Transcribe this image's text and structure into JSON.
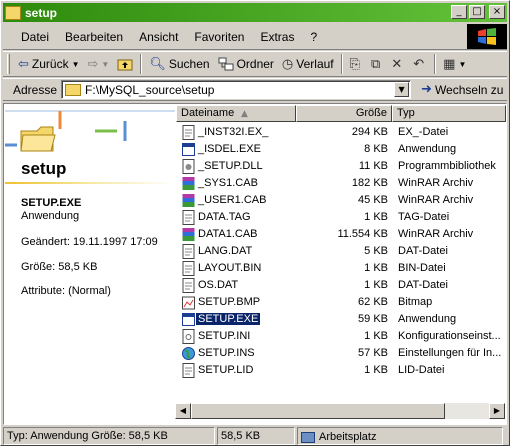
{
  "window": {
    "title": "setup",
    "minimize": "_",
    "maximize": "□",
    "close": "×"
  },
  "menu": [
    "Datei",
    "Bearbeiten",
    "Ansicht",
    "Favoriten",
    "Extras",
    "?"
  ],
  "toolbar": {
    "back": "Zurück",
    "search": "Suchen",
    "folders": "Ordner",
    "history": "Verlauf"
  },
  "address": {
    "label": "Adresse",
    "value": "F:\\MySQL_source\\setup",
    "go": "Wechseln zu"
  },
  "left_pane": {
    "folder_title": "setup",
    "file_name": "SETUP.EXE",
    "file_type": "Anwendung",
    "modified": "Geändert: 19.11.1997 17:09",
    "size": "Größe: 58,5 KB",
    "attributes": "Attribute: (Normal)"
  },
  "columns": {
    "name": "Dateiname",
    "size": "Größe",
    "type": "Typ"
  },
  "files": [
    {
      "name": "_INST32I.EX_",
      "size": "294 KB",
      "type": "EX_-Datei",
      "icon": "doc-icon"
    },
    {
      "name": "_ISDEL.EXE",
      "size": "8 KB",
      "type": "Anwendung",
      "icon": "app-icon"
    },
    {
      "name": "_SETUP.DLL",
      "size": "11 KB",
      "type": "Programmbibliothek",
      "icon": "dll-icon"
    },
    {
      "name": "_SYS1.CAB",
      "size": "182 KB",
      "type": "WinRAR Archiv",
      "icon": "archive-icon"
    },
    {
      "name": "_USER1.CAB",
      "size": "45 KB",
      "type": "WinRAR Archiv",
      "icon": "archive-icon"
    },
    {
      "name": "DATA.TAG",
      "size": "1 KB",
      "type": "TAG-Datei",
      "icon": "doc-icon"
    },
    {
      "name": "DATA1.CAB",
      "size": "11.554 KB",
      "type": "WinRAR Archiv",
      "icon": "archive-icon"
    },
    {
      "name": "LANG.DAT",
      "size": "5 KB",
      "type": "DAT-Datei",
      "icon": "doc-icon"
    },
    {
      "name": "LAYOUT.BIN",
      "size": "1 KB",
      "type": "BIN-Datei",
      "icon": "doc-icon"
    },
    {
      "name": "OS.DAT",
      "size": "1 KB",
      "type": "DAT-Datei",
      "icon": "doc-icon"
    },
    {
      "name": "SETUP.BMP",
      "size": "62 KB",
      "type": "Bitmap",
      "icon": "bitmap-icon"
    },
    {
      "name": "SETUP.EXE",
      "size": "59 KB",
      "type": "Anwendung",
      "icon": "app-icon",
      "selected": true
    },
    {
      "name": "SETUP.INI",
      "size": "1 KB",
      "type": "Konfigurationseinst...",
      "icon": "ini-icon"
    },
    {
      "name": "SETUP.INS",
      "size": "57 KB",
      "type": "Einstellungen für In...",
      "icon": "globe-icon"
    },
    {
      "name": "SETUP.LID",
      "size": "1 KB",
      "type": "LID-Datei",
      "icon": "doc-icon"
    }
  ],
  "status": {
    "left": "Typ: Anwendung Größe: 58,5 KB",
    "size": "58,5 KB",
    "zone": "Arbeitsplatz"
  },
  "colors": {
    "title_start": "#2d8a0c",
    "title_end": "#64c23a",
    "selection": "#0a246a",
    "face": "#d4d0c8"
  }
}
